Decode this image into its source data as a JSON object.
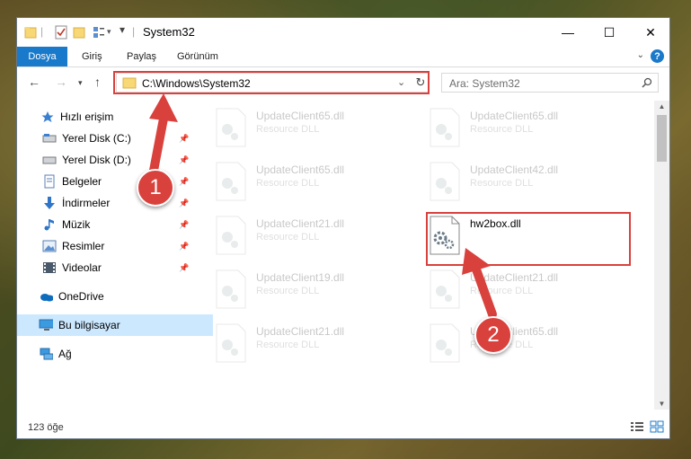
{
  "window": {
    "title": "System32",
    "controls": {
      "minimize": "—",
      "maximize": "☐",
      "close": "✕"
    }
  },
  "ribbon": {
    "file_tab": "Dosya",
    "tabs": [
      "Giriş",
      "Paylaş",
      "Görünüm"
    ],
    "help": "?"
  },
  "nav": {
    "address": "C:\\Windows\\System32",
    "search_placeholder": "Ara: System32"
  },
  "sidebar": {
    "items": [
      {
        "label": "Hızlı erişim",
        "icon": "star-icon"
      },
      {
        "label": "Yerel Disk (C:)",
        "icon": "drive-icon"
      },
      {
        "label": "Yerel Disk (D:)",
        "icon": "drive-icon"
      },
      {
        "label": "Belgeler",
        "icon": "documents-icon"
      },
      {
        "label": "İndirmeler",
        "icon": "download-icon"
      },
      {
        "label": "Müzik",
        "icon": "music-icon"
      },
      {
        "label": "Resimler",
        "icon": "pictures-icon"
      },
      {
        "label": "Videolar",
        "icon": "videos-icon"
      },
      {
        "label": "OneDrive",
        "icon": "cloud-icon"
      },
      {
        "label": "Bu bilgisayar",
        "icon": "computer-icon"
      },
      {
        "label": "Ağ",
        "icon": "network-icon"
      }
    ]
  },
  "files": [
    {
      "name": "UpdateClient65.dll",
      "type": "Resource DLL"
    },
    {
      "name": "UpdateClient65.dll",
      "type": "Resource DLL"
    },
    {
      "name": "UpdateClient65.dll",
      "type": "Resource DLL"
    },
    {
      "name": "UpdateClient42.dll",
      "type": "Resource DLL"
    },
    {
      "name": "UpdateClient21.dll",
      "type": "Resource DLL"
    },
    {
      "name": "hw2box.dll",
      "type": ""
    },
    {
      "name": "UpdateClient19.dll",
      "type": "Resource DLL"
    },
    {
      "name": "UpdateClient21.dll",
      "type": "Resource DLL"
    },
    {
      "name": "UpdateClient21.dll",
      "type": "Resource DLL"
    },
    {
      "name": "UpdateClient65.dll",
      "type": "Resource DLL"
    }
  ],
  "status": {
    "count": "123 öğe"
  },
  "annotations": {
    "step1": "1",
    "step2": "2"
  },
  "colors": {
    "accent": "#1979ca",
    "highlight": "#d9413d",
    "selected": "#cce8ff"
  }
}
